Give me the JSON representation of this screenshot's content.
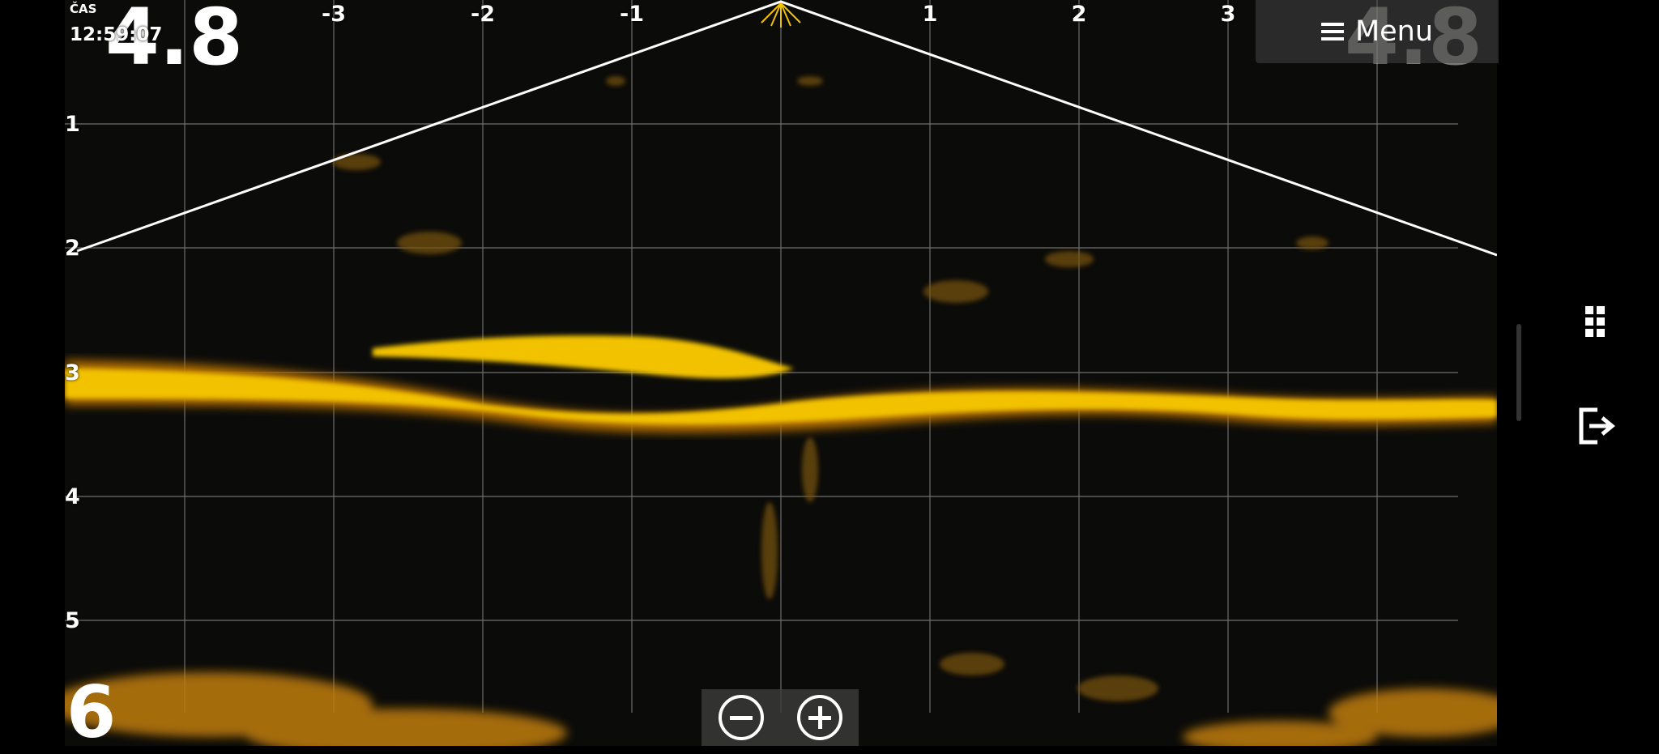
{
  "top_left": {
    "time_label": "ČAS",
    "time_value": "12:59:07",
    "depth_readout": "4.8"
  },
  "top_right": {
    "depth_readout": "4.8"
  },
  "menu": {
    "label": "Menu",
    "icon": "hamburger-icon"
  },
  "bottom_left": {
    "range_readout": "6"
  },
  "x_axis_ticks": [
    "-3",
    "-2",
    "-1",
    "1",
    "2",
    "3"
  ],
  "y_axis_ticks": [
    "1",
    "2",
    "3",
    "4",
    "5"
  ],
  "zoom": {
    "out_icon": "minus-circle-icon",
    "in_icon": "plus-circle-icon"
  },
  "side_panel": {
    "icons": [
      "grid-dots-icon",
      "exit-icon"
    ]
  },
  "colors": {
    "sonar_return": "#f2c200",
    "background": "#0b0b09",
    "grid": "#8a8a8a",
    "cone": "#ffffff"
  }
}
